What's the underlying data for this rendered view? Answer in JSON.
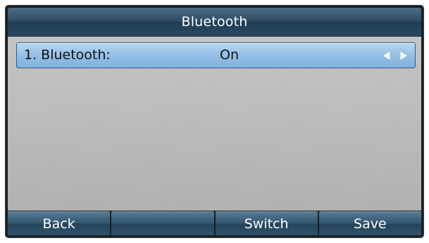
{
  "header": {
    "title": "Bluetooth"
  },
  "settings": {
    "items": [
      {
        "label": "1. Bluetooth:",
        "value": "On",
        "left_icon": "triangle-left-icon",
        "right_icon": "triangle-right-icon"
      }
    ]
  },
  "softkeys": [
    {
      "label": "Back"
    },
    {
      "label": ""
    },
    {
      "label": "Switch"
    },
    {
      "label": "Save"
    }
  ],
  "colors": {
    "header_blue": "#2d4c64",
    "selected_row": "#95c0e6",
    "content_gray": "#bcbcba",
    "arrow_white": "#ffffff"
  }
}
